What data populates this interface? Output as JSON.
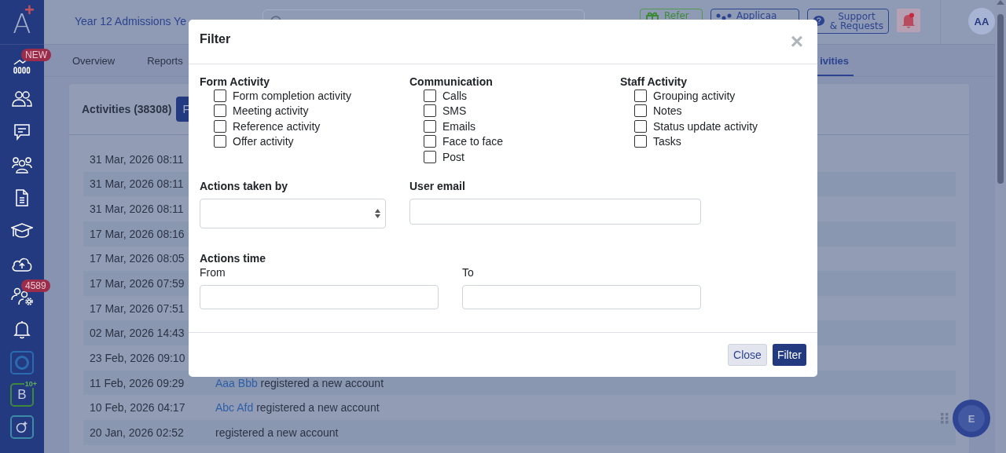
{
  "logo": {
    "letter": "A",
    "mark": "+"
  },
  "sidebar": {
    "items": [
      {
        "kind": "dashboard",
        "badge": "NEW"
      },
      {
        "kind": "people"
      },
      {
        "kind": "chat"
      },
      {
        "kind": "group"
      },
      {
        "kind": "document"
      },
      {
        "kind": "graduation"
      },
      {
        "kind": "upload"
      },
      {
        "kind": "user-settings",
        "badge": "4589"
      },
      {
        "kind": "bell"
      }
    ],
    "apps": [
      {
        "kind": "ring"
      },
      {
        "kind": "letter",
        "letter": "B",
        "sup": "10+"
      },
      {
        "kind": "plus-ring"
      }
    ]
  },
  "header": {
    "title": "Year 12 Admissions Ye",
    "buttons": [
      {
        "kind": "refer",
        "lines": [
          "Refer"
        ]
      },
      {
        "kind": "applicaa",
        "lines": [
          "Applicaa"
        ]
      },
      {
        "kind": "support",
        "lines": [
          "Support",
          "& Requests"
        ]
      }
    ],
    "notifications": {
      "unread": true
    },
    "avatar": "AA"
  },
  "tabs": [
    {
      "label": "Overview",
      "selected": false
    },
    {
      "label": "Reports",
      "selected": false
    },
    {
      "label": "ivities",
      "selected": true
    }
  ],
  "activities": {
    "title": "Activities (38308)",
    "button": "F",
    "rows": [
      {
        "date": "31 Mar, 2026 08:11"
      },
      {
        "date": "31 Mar, 2026 08:11"
      },
      {
        "date": "31 Mar, 2026 08:11"
      },
      {
        "date": "17 Mar, 2026 08:16"
      },
      {
        "date": "17 Mar, 2026 08:05"
      },
      {
        "date": "17 Mar, 2026 07:59"
      },
      {
        "date": "17 Mar, 2026 07:51"
      },
      {
        "date": "02 Mar, 2026 14:43"
      },
      {
        "date": "23 Feb, 2026 09:10"
      },
      {
        "date": "11 Feb, 2026 09:29",
        "user": "Aaa Bbb",
        "action": "registered a new account"
      },
      {
        "date": "10 Feb, 2026 04:17",
        "user": "Abc Afd",
        "action": "registered a new account"
      },
      {
        "date": "20 Jan, 2026 02:52",
        "action": "registered a new account"
      }
    ]
  },
  "chat_button": {
    "label": "E"
  },
  "modal": {
    "title": "Filter",
    "close": "×",
    "groups": [
      {
        "title": "Form Activity",
        "options": [
          {
            "label": "Form completion activity",
            "checked": false
          },
          {
            "label": "Meeting activity",
            "checked": false
          },
          {
            "label": "Reference activity",
            "checked": false
          },
          {
            "label": "Offer activity",
            "checked": false
          }
        ]
      },
      {
        "title": "Communication",
        "options": [
          {
            "label": "Calls",
            "checked": false
          },
          {
            "label": "SMS",
            "checked": false
          },
          {
            "label": "Emails",
            "checked": false
          },
          {
            "label": "Face to face",
            "checked": false
          },
          {
            "label": "Post",
            "checked": false
          }
        ]
      },
      {
        "title": "Staff Activity",
        "options": [
          {
            "label": "Grouping activity",
            "checked": false
          },
          {
            "label": "Notes",
            "checked": false
          },
          {
            "label": "Status update activity",
            "checked": false
          },
          {
            "label": "Tasks",
            "checked": false
          }
        ]
      }
    ],
    "actions_taken_by": {
      "label": "Actions taken by"
    },
    "user_email": {
      "label": "User email"
    },
    "actions_time": {
      "label": "Actions time",
      "from": "From",
      "to": "To"
    },
    "buttons": {
      "close": "Close",
      "filter": "Filter"
    }
  }
}
